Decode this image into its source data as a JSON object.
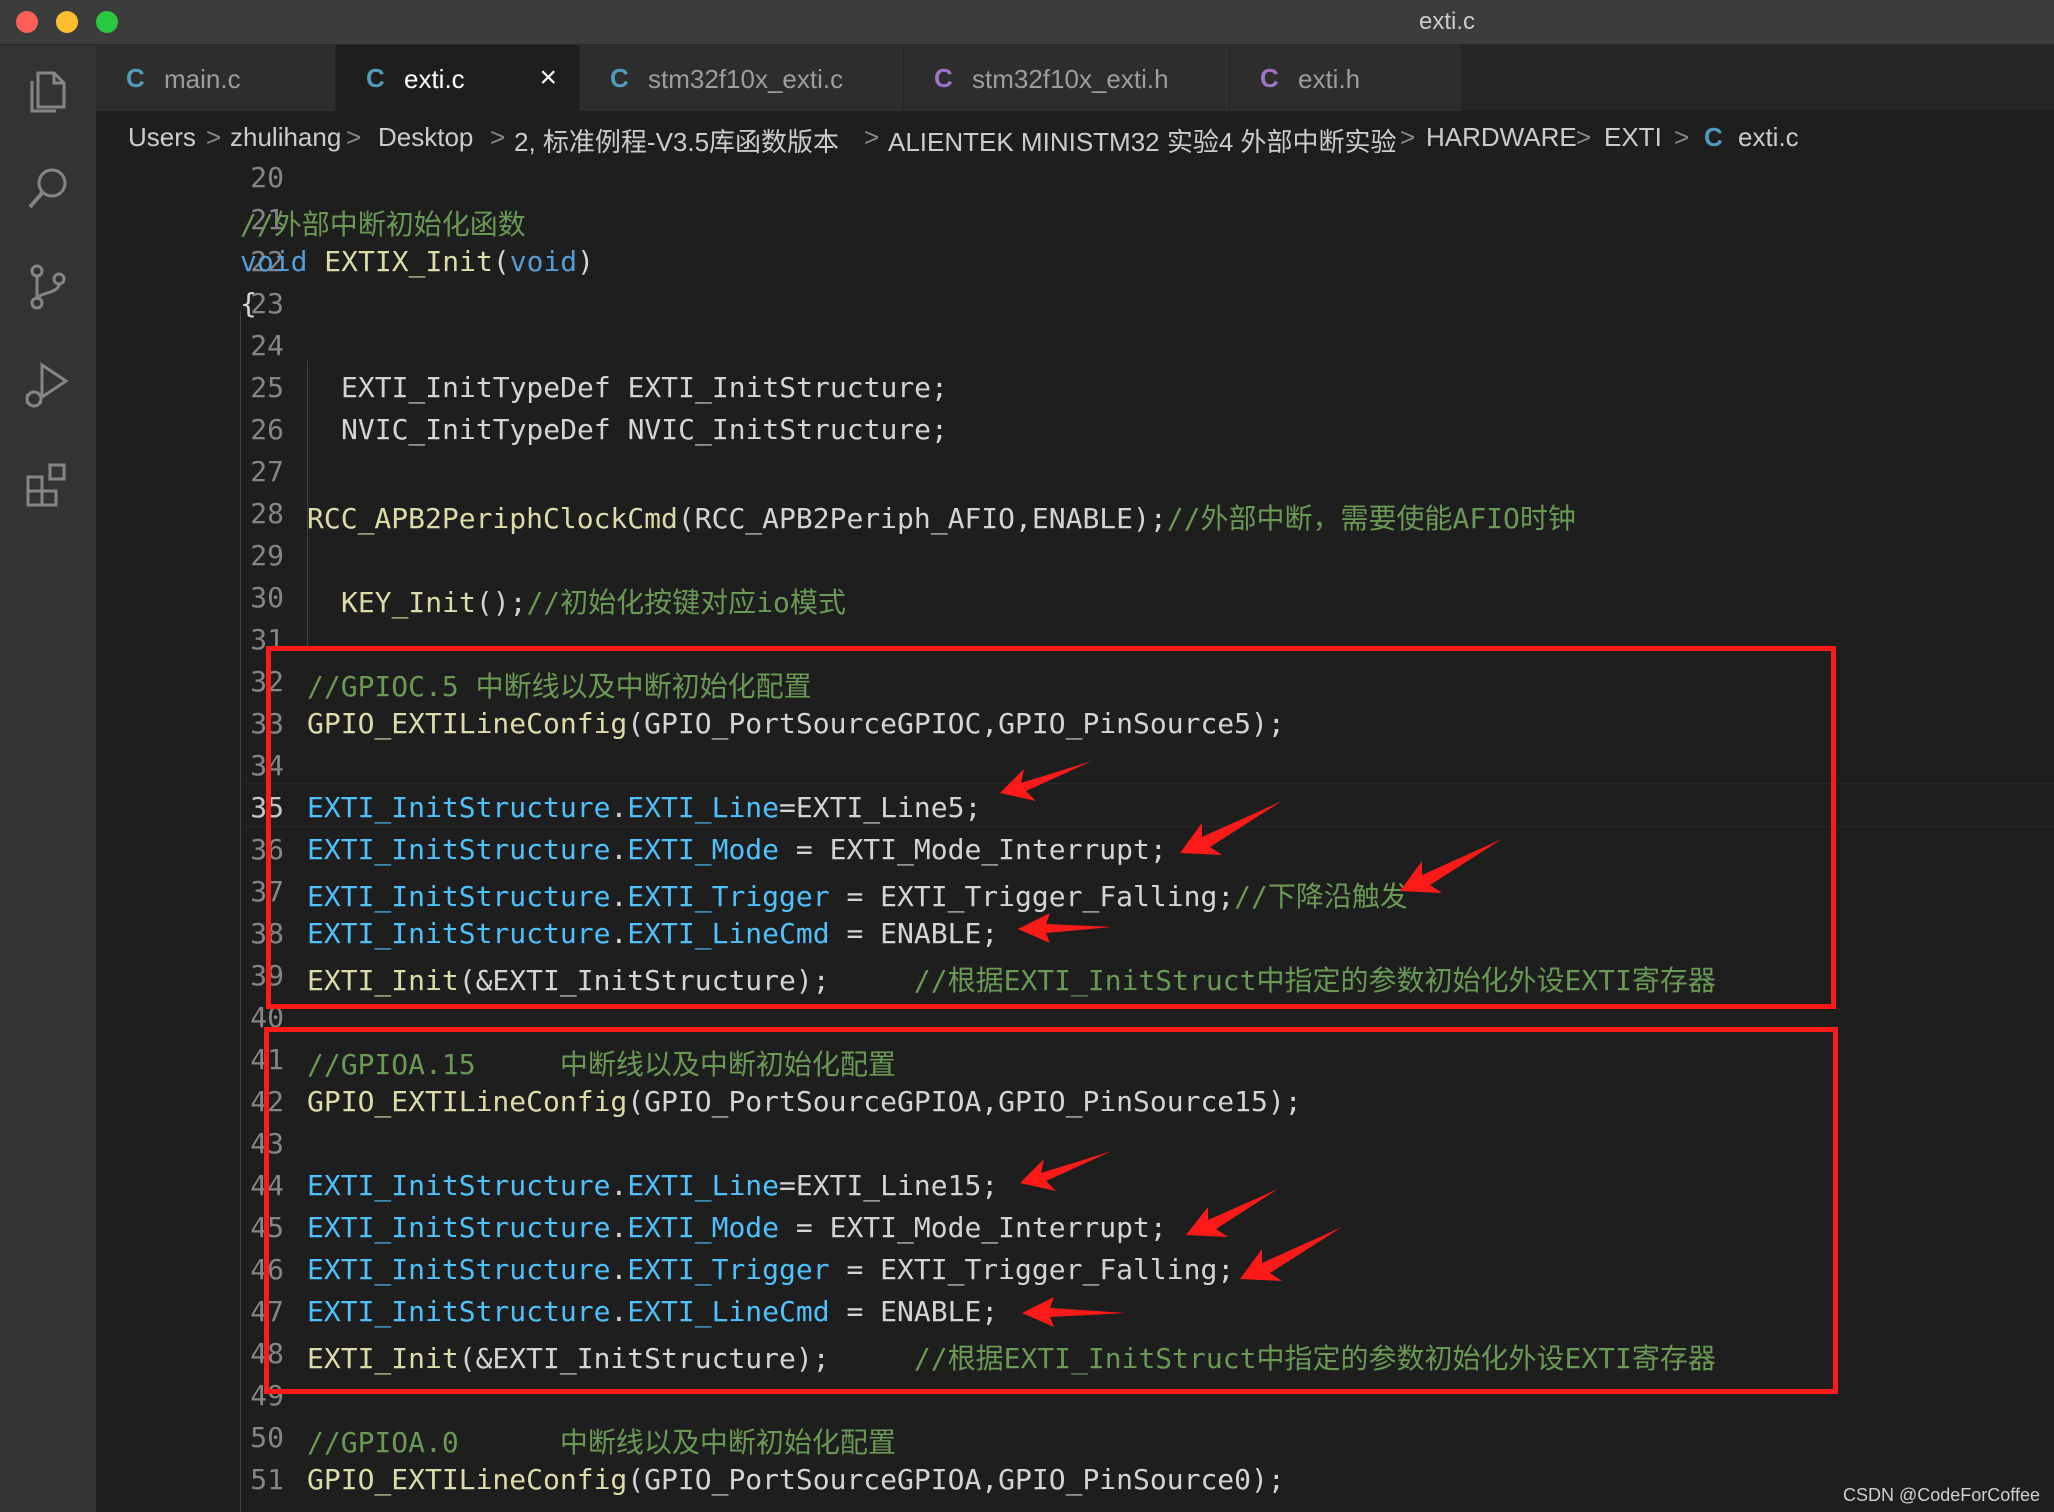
{
  "window": {
    "title": "exti.c"
  },
  "colors": {
    "accent_c_icon": "#519aba",
    "c_header_icon": "#a074c4",
    "annotation_red": "#ff1a1a"
  },
  "activity_icons": [
    "explorer-icon",
    "search-icon",
    "source-control-icon",
    "run-debug-icon",
    "extensions-icon"
  ],
  "tabs": [
    {
      "icon": "C",
      "label": "main.c"
    },
    {
      "icon": "C",
      "label": "exti.c",
      "active": true,
      "close": "×"
    },
    {
      "icon": "C",
      "label": "stm32f10x_exti.c"
    },
    {
      "icon": "C",
      "label": "stm32f10x_exti.h"
    },
    {
      "icon": "C",
      "label": "exti.h"
    }
  ],
  "breadcrumb": {
    "separator": ">",
    "items": [
      "Users",
      "zhulihang",
      "Desktop",
      "2, 标准例程-V3.5库函数版本",
      "ALIENTEK MINISTM32 实验4 外部中断实验",
      "HARDWARE",
      "EXTI"
    ],
    "file_icon": "C",
    "file": "exti.c"
  },
  "editor": {
    "current_line": "35",
    "line_numbers": [
      "20",
      "21",
      "22",
      "23",
      "24",
      "25",
      "26",
      "27",
      "28",
      "29",
      "30",
      "31",
      "32",
      "33",
      "34",
      "35",
      "36",
      "37",
      "38",
      "39",
      "40",
      "41",
      "42",
      "43",
      "44",
      "45",
      "46",
      "47",
      "48",
      "49",
      "50",
      "51"
    ],
    "code": {
      "l21": {
        "comment": "//外部中断初始化函数"
      },
      "l22": {
        "kw1": "void",
        "fn": " EXTIX_Init",
        "p1": "(",
        "kw2": "void",
        "p2": ")"
      },
      "l23": {
        "text": "{"
      },
      "l25": {
        "text": "EXTI_InitTypeDef EXTI_InitStructure;"
      },
      "l26": {
        "text": "NVIC_InitTypeDef NVIC_InitStructure;"
      },
      "l28": {
        "fn": "RCC_APB2PeriphClockCmd",
        "text": "(RCC_APB2Periph_AFIO,ENABLE);",
        "comment": "//外部中断，需要使能AFIO时钟"
      },
      "l30": {
        "fn": "KEY_Init",
        "text": "();",
        "comment": "//初始化按键对应io模式"
      },
      "l32": {
        "comment": "//GPIOC.5 中断线以及中断初始化配置"
      },
      "l33": {
        "fn": "GPIO_EXTILineConfig",
        "text": "(GPIO_PortSourceGPIOC,GPIO_PinSource5);"
      },
      "l35": {
        "v1": "EXTI_InitStructure",
        "dot": ".",
        "v2": "EXTI_Line",
        "text": "=EXTI_Line5;"
      },
      "l36": {
        "v1": "EXTI_InitStructure",
        "dot": ".",
        "v2": "EXTI_Mode",
        "text": " = EXTI_Mode_Interrupt;"
      },
      "l37": {
        "v1": "EXTI_InitStructure",
        "dot": ".",
        "v2": "EXTI_Trigger",
        "text": " = EXTI_Trigger_Falling;",
        "comment": "//下降沿触发"
      },
      "l38": {
        "v1": "EXTI_InitStructure",
        "dot": ".",
        "v2": "EXTI_LineCmd",
        "text": " = ENABLE;"
      },
      "l39": {
        "fn": "EXTI_Init",
        "text": "(&EXTI_InitStructure);     ",
        "comment": "//根据EXTI_InitStruct中指定的参数初始化外设EXTI寄存器"
      },
      "l41": {
        "comment": "//GPIOA.15     中断线以及中断初始化配置"
      },
      "l42": {
        "fn": "GPIO_EXTILineConfig",
        "text": "(GPIO_PortSourceGPIOA,GPIO_PinSource15);"
      },
      "l44": {
        "v1": "EXTI_InitStructure",
        "dot": ".",
        "v2": "EXTI_Line",
        "text": "=EXTI_Line15;"
      },
      "l45": {
        "v1": "EXTI_InitStructure",
        "dot": ".",
        "v2": "EXTI_Mode",
        "text": " = EXTI_Mode_Interrupt;"
      },
      "l46": {
        "v1": "EXTI_InitStructure",
        "dot": ".",
        "v2": "EXTI_Trigger",
        "text": " = EXTI_Trigger_Falling;"
      },
      "l47": {
        "v1": "EXTI_InitStructure",
        "dot": ".",
        "v2": "EXTI_LineCmd",
        "text": " = ENABLE;"
      },
      "l48": {
        "fn": "EXTI_Init",
        "text": "(&EXTI_InitStructure);     ",
        "comment": "//根据EXTI_InitStruct中指定的参数初始化外设EXTI寄存器"
      },
      "l50": {
        "comment": "//GPIOA.0      中断线以及中断初始化配置"
      },
      "l51": {
        "fn": "GPIO_EXTILineConfig",
        "text": "(GPIO_PortSourceGPIOA,GPIO_PinSource0);"
      }
    }
  },
  "watermark": "CSDN @CodeForCoffee"
}
